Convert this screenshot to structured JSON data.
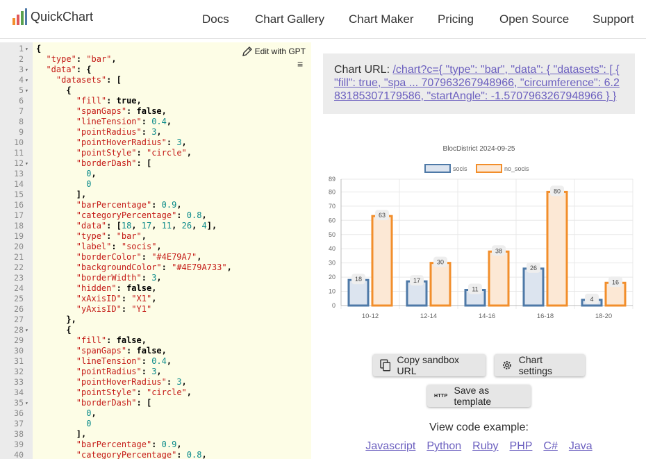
{
  "brand": {
    "name": "QuickChart"
  },
  "nav": {
    "links": [
      "Docs",
      "Chart Gallery",
      "Chart Maker",
      "Pricing",
      "Open Source",
      "Support"
    ]
  },
  "editor": {
    "gpt_label": "Edit with GPT",
    "line_numbers": [
      "1",
      "2",
      "3",
      "4",
      "5",
      "6",
      "7",
      "8",
      "9",
      "10",
      "11",
      "12",
      "13",
      "14",
      "15",
      "16",
      "17",
      "18",
      "19",
      "20",
      "21",
      "22",
      "23",
      "24",
      "25",
      "26",
      "27",
      "28",
      "29",
      "30",
      "31",
      "32",
      "33",
      "34",
      "35",
      "36",
      "37",
      "38",
      "39",
      "40"
    ],
    "lines": [
      "{",
      "  \"type\": \"bar\",",
      "  \"data\": {",
      "    \"datasets\": [",
      "      {",
      "        \"fill\": true,",
      "        \"spanGaps\": false,",
      "        \"lineTension\": 0.4,",
      "        \"pointRadius\": 3,",
      "        \"pointHoverRadius\": 3,",
      "        \"pointStyle\": \"circle\",",
      "        \"borderDash\": [",
      "          0,",
      "          0",
      "        ],",
      "        \"barPercentage\": 0.9,",
      "        \"categoryPercentage\": 0.8,",
      "        \"data\": [18, 17, 11, 26, 4],",
      "        \"type\": \"bar\",",
      "        \"label\": \"socis\",",
      "        \"borderColor\": \"#4E79A7\",",
      "        \"backgroundColor\": \"#4E79A733\",",
      "        \"borderWidth\": 3,",
      "        \"hidden\": false,",
      "        \"xAxisID\": \"X1\",",
      "        \"yAxisID\": \"Y1\"",
      "      },",
      "      {",
      "        \"fill\": false,",
      "        \"spanGaps\": false,",
      "        \"lineTension\": 0.4,",
      "        \"pointRadius\": 3,",
      "        \"pointHoverRadius\": 3,",
      "        \"pointStyle\": \"circle\",",
      "        \"borderDash\": [",
      "          0,",
      "          0",
      "        ],",
      "        \"barPercentage\": 0.9,",
      "        \"categoryPercentage\": 0.8,"
    ],
    "fold_lines": [
      1,
      3,
      4,
      5,
      12,
      28,
      35
    ]
  },
  "chart_url": {
    "label": "Chart URL:",
    "link_lines": [
      "/chart?c={ \"type\": \"bar\", \"data\": { \"datasets\": [ {",
      "\"fill\": true, \"spa ... 707963267948966, \"circumference\": 6.2",
      "83185307179586, \"startAngle\": -1.5707963267948966 } }"
    ]
  },
  "chart_data": {
    "type": "bar",
    "title": "BlocDistrict 2024-09-25",
    "categories": [
      "10-12",
      "12-14",
      "14-16",
      "16-18",
      "18-20"
    ],
    "series": [
      {
        "name": "socis",
        "values": [
          18,
          17,
          11,
          26,
          4
        ],
        "border": "#4E79A7",
        "fill": "#dce4ef"
      },
      {
        "name": "no_socis",
        "values": [
          63,
          30,
          38,
          80,
          16
        ],
        "border": "#F28E2B",
        "fill": "#fce8d5"
      }
    ],
    "y_ticks": [
      "0",
      "10",
      "20",
      "30",
      "40",
      "50",
      "60",
      "70",
      "80",
      "89"
    ],
    "ylim": [
      0,
      89
    ],
    "legend": "top",
    "grid": true,
    "data_labels": true
  },
  "buttons": {
    "copy_sandbox": "Copy sandbox URL",
    "chart_settings": "Chart settings",
    "save_template": "Save as template",
    "http_badge": "HTTP"
  },
  "view_code": {
    "label": "View code example:",
    "languages": [
      "Javascript",
      "Python",
      "Ruby",
      "PHP",
      "C#",
      "Java"
    ]
  }
}
